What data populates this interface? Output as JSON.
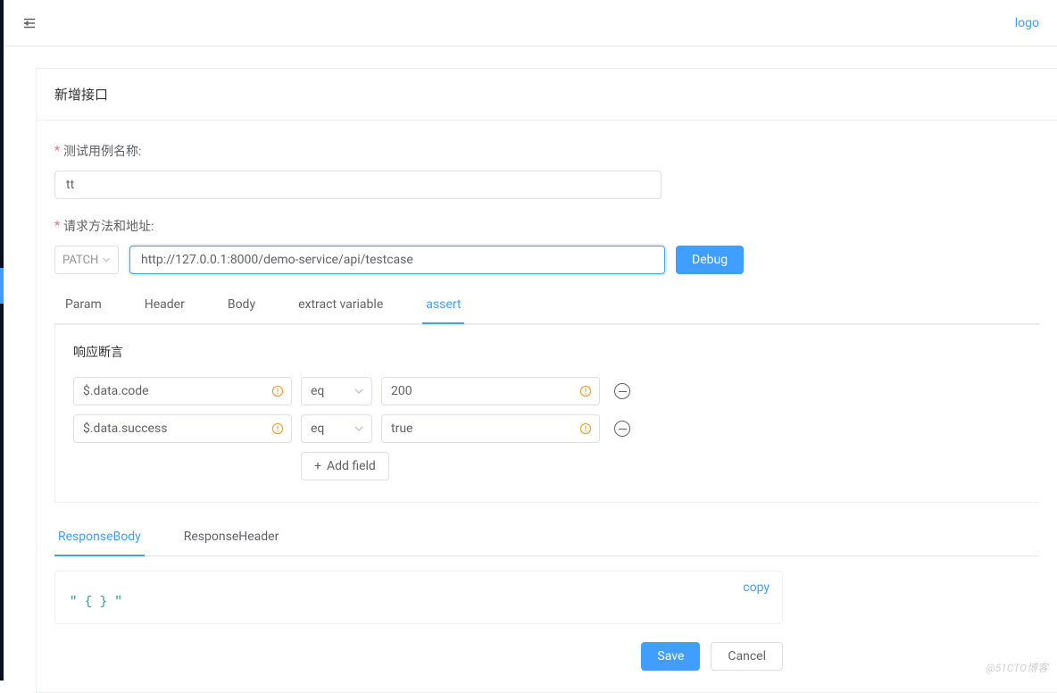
{
  "topbar": {
    "logo_text": "logo"
  },
  "panel": {
    "title": "新增接口"
  },
  "form": {
    "name_label": "测试用例名称:",
    "name_value": "tt",
    "method_label": "请求方法和地址:",
    "method_value": "PATCH",
    "url_value": "http://127.0.0.1:8000/demo-service/api/testcase",
    "debug_label": "Debug"
  },
  "tabs": {
    "param": "Param",
    "header": "Header",
    "body": "Body",
    "extract": "extract variable",
    "assert": "assert"
  },
  "assert_section": {
    "title": "响应断言",
    "rows": [
      {
        "path": "$.data.code",
        "op": "eq",
        "expect": "200"
      },
      {
        "path": "$.data.success",
        "op": "eq",
        "expect": "true"
      }
    ],
    "add_field_label": "Add field"
  },
  "response_tabs": {
    "body": "ResponseBody",
    "header": "ResponseHeader"
  },
  "response": {
    "copy_label": "copy",
    "body_text": "\" { } \""
  },
  "footer": {
    "save": "Save",
    "cancel": "Cancel"
  },
  "watermark": "@51CTO博客"
}
